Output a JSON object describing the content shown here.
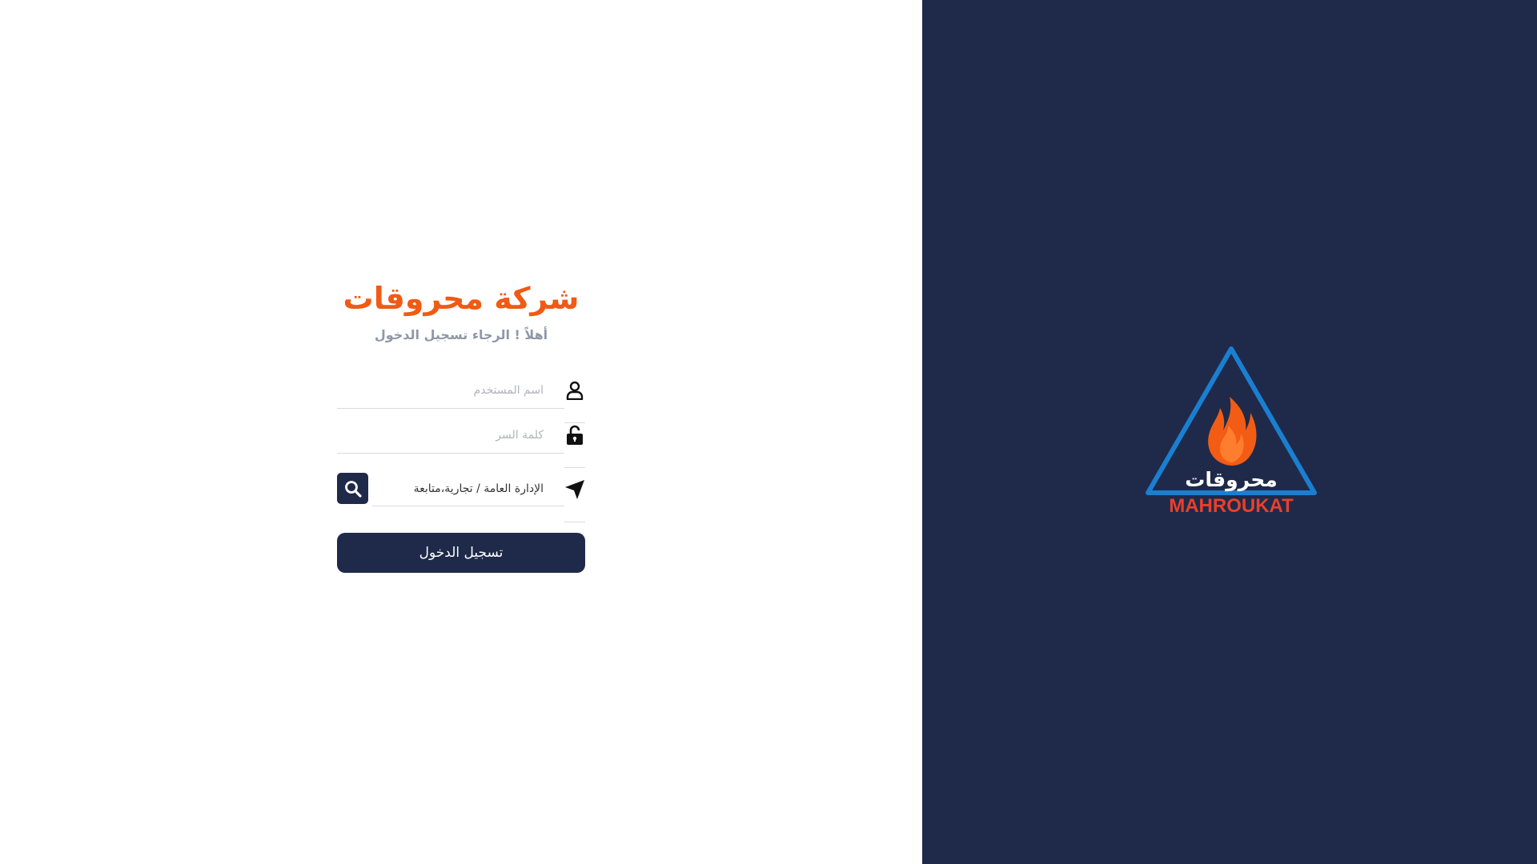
{
  "brand": {
    "title": "شركة محروقات",
    "subtitle": "أهلاً ! الرجاء تسجيل الدخول",
    "logo_text_ar": "محروقات",
    "logo_text_en": "MAHROUKAT",
    "colors": {
      "accent": "#f05a14",
      "navy": "#1f2a4a",
      "logo_blue": "#1a7fd0",
      "logo_red": "#e8402a"
    }
  },
  "form": {
    "username": {
      "placeholder": "اسم المستخدم",
      "value": "",
      "icon": "user-icon"
    },
    "password": {
      "placeholder": "كلمة السر",
      "value": "",
      "icon": "unlock-icon"
    },
    "location": {
      "value": "الإدارة العامة / تجارية،متابعة",
      "icon": "location-arrow-icon",
      "search_icon": "search-icon"
    },
    "login_label": "تسجيل الدخول"
  }
}
